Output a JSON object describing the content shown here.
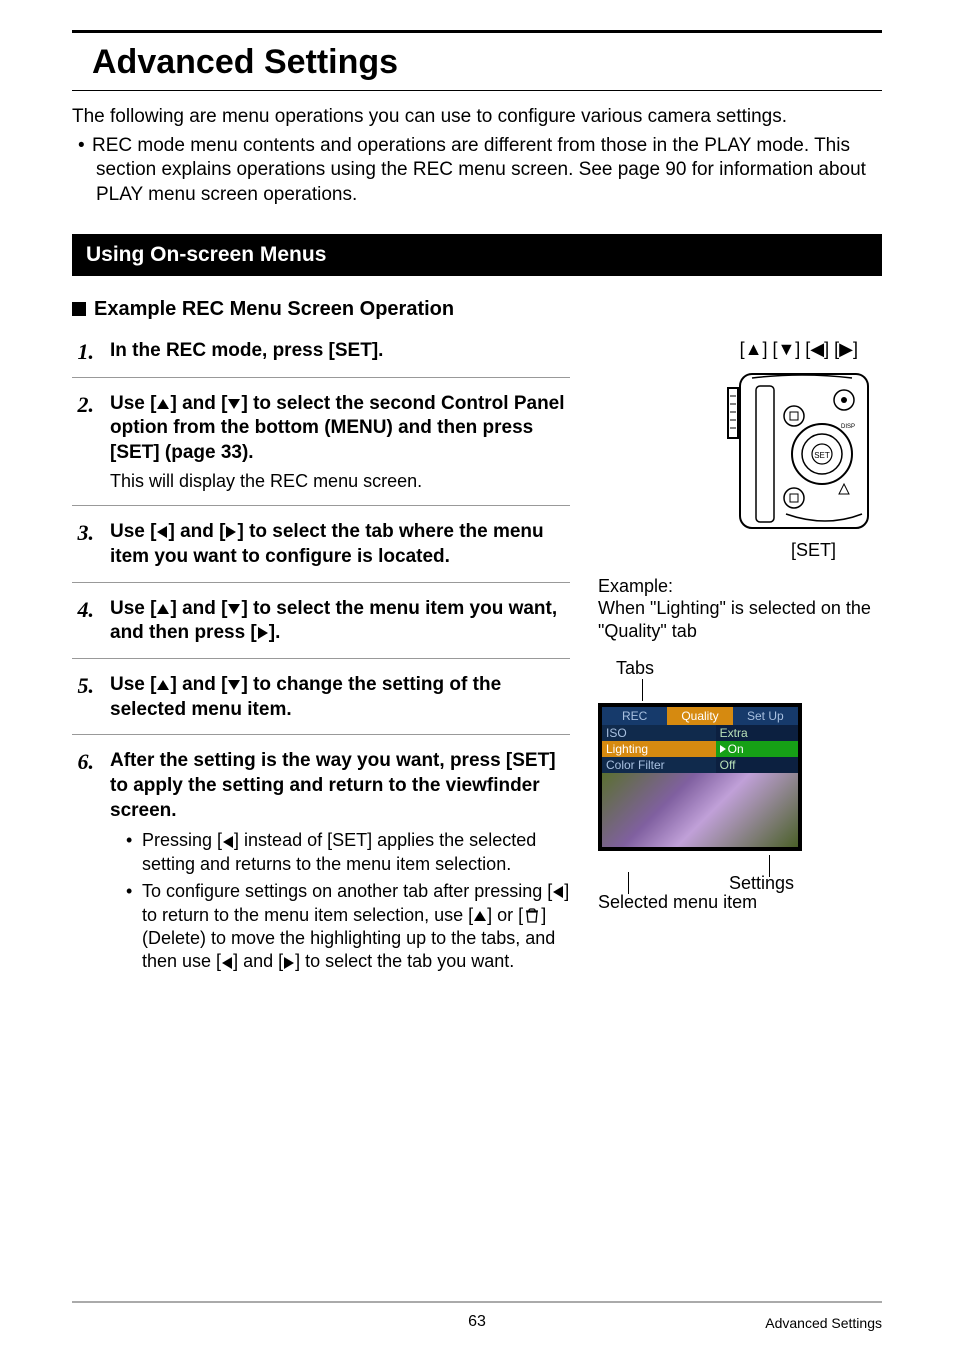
{
  "page": {
    "title": "Advanced Settings",
    "intro": "The following are menu operations you can use to configure various camera settings.",
    "intro_bullet": "REC mode menu contents and operations are different from those in the PLAY mode. This section explains operations using the REC menu screen. See page 90 for information about PLAY menu screen operations."
  },
  "section": {
    "bar": "Using On-screen Menus",
    "subhead": "Example REC Menu Screen Operation"
  },
  "steps": [
    {
      "strong": "In the REC mode, press [SET]."
    },
    {
      "strong_parts": [
        "Use [",
        "UP",
        "] and [",
        "DOWN",
        "] to select the second Control Panel option from the bottom (MENU) and then press [SET] (page 33)."
      ],
      "plain": "This will display the REC menu screen."
    },
    {
      "strong_parts": [
        "Use [",
        "LEFT",
        "] and [",
        "RIGHT",
        "] to select the tab where the menu item you want to configure is located."
      ]
    },
    {
      "strong_parts": [
        "Use [",
        "UP",
        "] and [",
        "DOWN",
        "] to select the menu item you want, and then press [",
        "RIGHT",
        "]."
      ]
    },
    {
      "strong_parts": [
        "Use [",
        "UP",
        "] and [",
        "DOWN",
        "] to change the setting of the selected menu item."
      ]
    },
    {
      "strong": "After the setting is the way you want, press [SET] to apply the setting and return to the viewfinder screen.",
      "bullets": [
        {
          "parts": [
            "Pressing [",
            "LEFT",
            "] instead of [SET] applies the selected setting and returns to the menu item selection."
          ]
        },
        {
          "parts": [
            "To configure settings on another tab after pressing [",
            "LEFT",
            "] to return to the menu item selection, use [",
            "UP",
            "] or [",
            "TRASH",
            "] (Delete) to move the highlighting up to the tabs, and then use [",
            "LEFT",
            "] and [",
            "RIGHT",
            "] to select the tab you want."
          ]
        }
      ]
    }
  ],
  "right": {
    "arrow_keys": "[▲] [▼] [◀] [▶]",
    "set_label": "[SET]",
    "example_line1": "Example:",
    "example_line2": "When \"Lighting\" is selected on the \"Quality\" tab",
    "tabs_label": "Tabs",
    "settings_label": "Settings",
    "selected_label": "Selected menu item"
  },
  "menu_screen": {
    "tabs": [
      "REC",
      "Quality",
      "Set Up"
    ],
    "left_items": [
      "ISO",
      "Lighting",
      "Color Filter"
    ],
    "left_selected_index": 1,
    "right_items": [
      "Extra",
      "On",
      "Off"
    ],
    "right_selected_index": 1
  },
  "footer": {
    "page": "63",
    "section": "Advanced Settings"
  }
}
